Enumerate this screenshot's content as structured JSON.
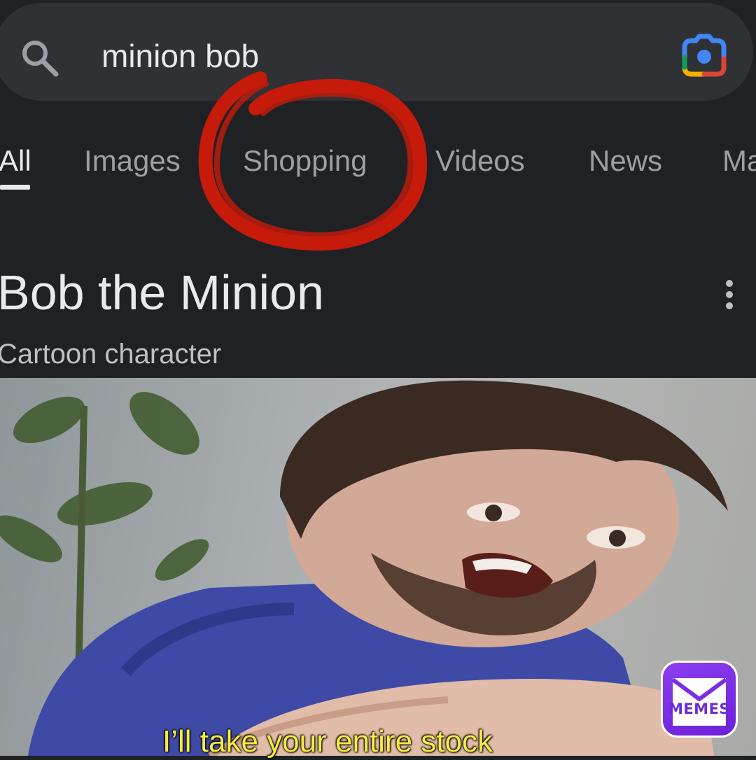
{
  "search": {
    "query": "minion bob",
    "search_icon": "search-icon",
    "lens_icon": "google-lens-icon"
  },
  "tabs": [
    {
      "label": "All",
      "active": true
    },
    {
      "label": "Images",
      "active": false
    },
    {
      "label": "Shopping",
      "active": false,
      "annotated": true
    },
    {
      "label": "Videos",
      "active": false
    },
    {
      "label": "News",
      "active": false
    },
    {
      "label": "Ma",
      "active": false
    }
  ],
  "knowledge_panel": {
    "title": "Bob the Minion",
    "subtitle": "Cartoon character",
    "menu_icon": "more-vert-icon"
  },
  "meme": {
    "caption": "I’ll take your entire stock",
    "watermark_label": "MEMES"
  },
  "colors": {
    "background": "#202124",
    "search_bar": "#303134",
    "text_primary": "#e8eaed",
    "text_secondary": "#9aa0a6",
    "annotation_red": "#c61a0b",
    "caption_yellow": "#f7ec41",
    "memes_purple": "#7b2ee6"
  }
}
